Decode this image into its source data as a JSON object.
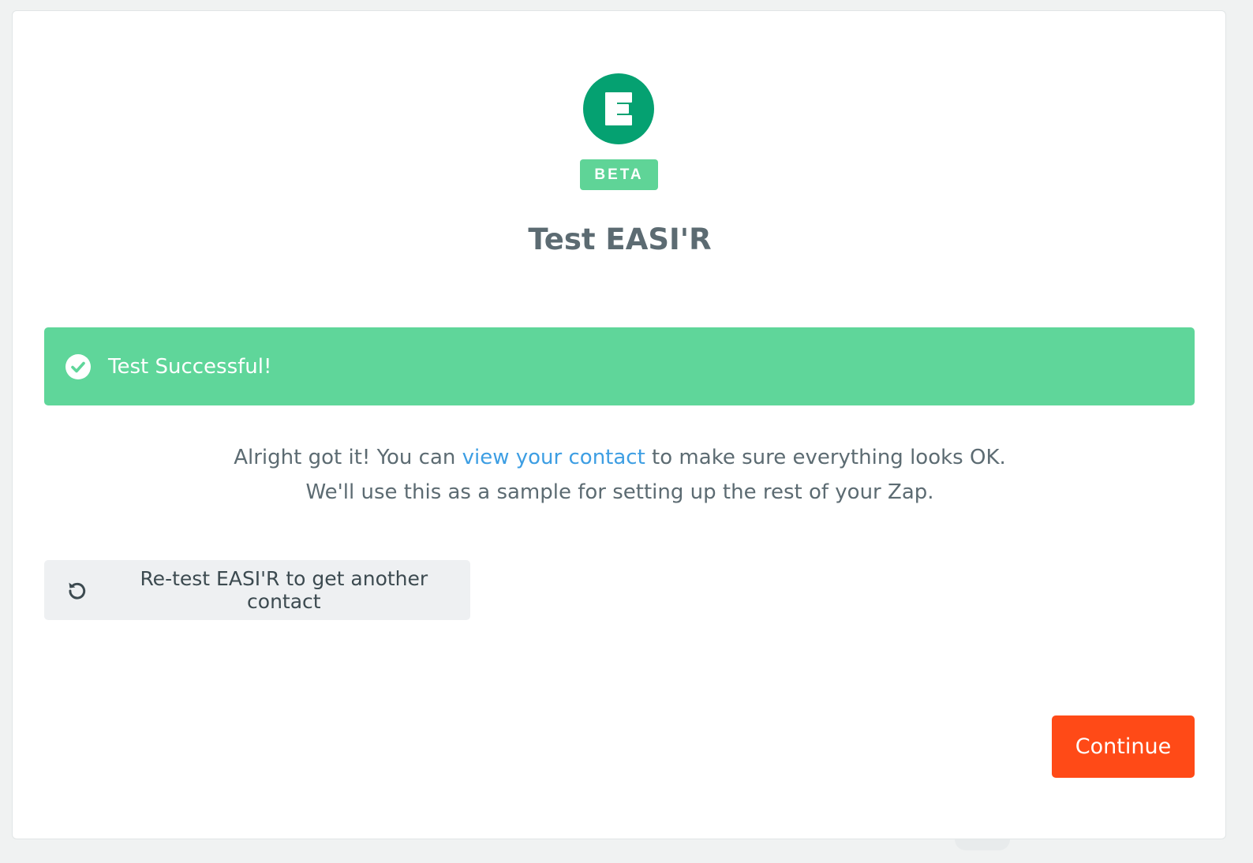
{
  "app": {
    "logo_letter": "E",
    "badge": "BETA",
    "title": "Test EASI'R"
  },
  "status": {
    "text": "Test Successful!",
    "icon": "check-circle-icon"
  },
  "message": {
    "line1_before": "Alright got it! You can ",
    "line1_link": "view your contact",
    "line1_after": " to make sure everything looks OK.",
    "line2": "We'll use this as a sample for setting up the rest of your Zap."
  },
  "actions": {
    "retest_label": "Re-test EASI'R to get another contact",
    "retest_icon": "refresh-icon",
    "continue_label": "Continue"
  },
  "colors": {
    "brand_green": "#05a171",
    "beta_green": "#5fd497",
    "success_green": "#5fd69a",
    "link_blue": "#3d9ee3",
    "continue_orange": "#ff4a17"
  }
}
